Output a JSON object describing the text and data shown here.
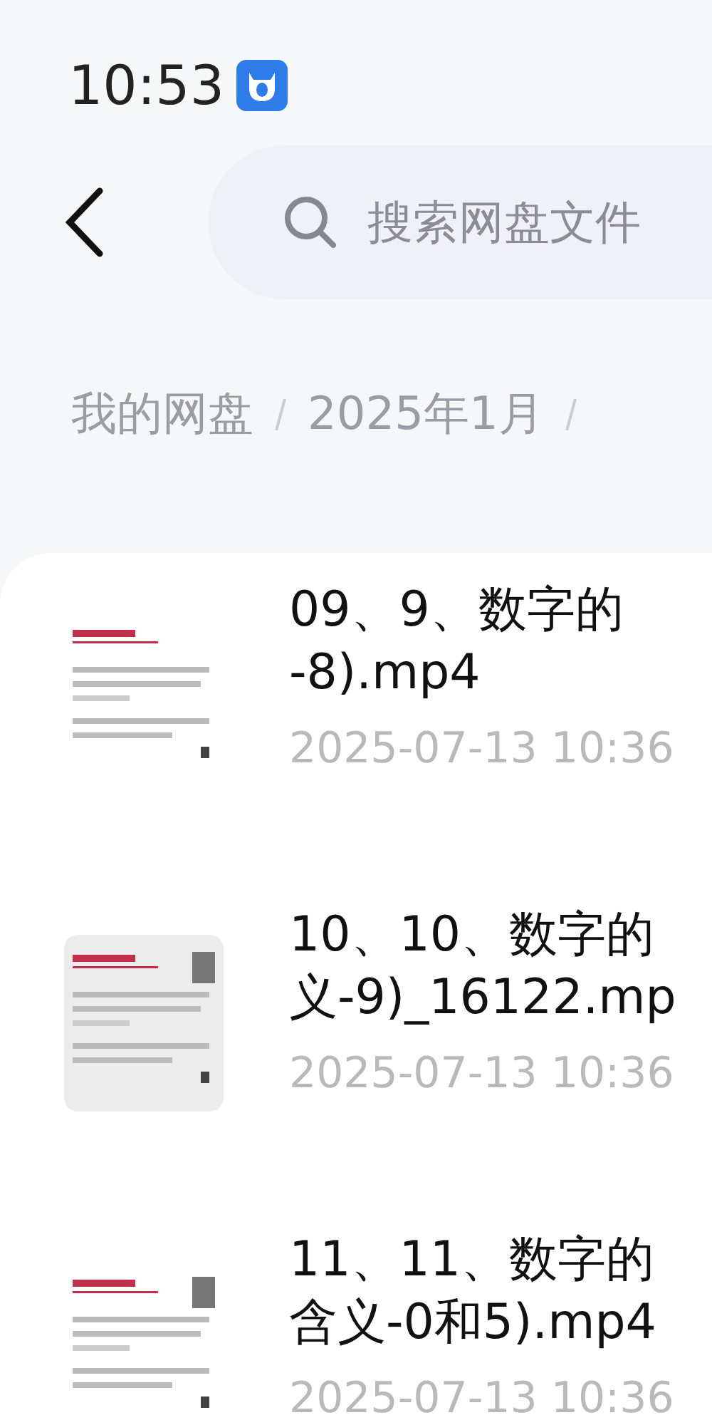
{
  "status_bar": {
    "time": "10:53"
  },
  "search": {
    "placeholder": "搜索网盘文件"
  },
  "breadcrumb": [
    "我的网盘",
    "2025年1月"
  ],
  "files": [
    {
      "thumbnail": {
        "kind": "picture"
      },
      "name_lines": [
        "09、9、数字的",
        "-8).mp4"
      ],
      "date": "2025-07-13  10:36"
    },
    {
      "thumbnail": {
        "kind": "picture"
      },
      "name_lines": [
        "10、10、数字的",
        "义-9)_16122.mp"
      ],
      "date": "2025-07-13  10:36"
    },
    {
      "thumbnail": {
        "kind": "picture"
      },
      "name_lines": [
        "11、11、数字的",
        "含义-0和5).mp4"
      ],
      "date": "2025-07-13  10:36"
    }
  ]
}
